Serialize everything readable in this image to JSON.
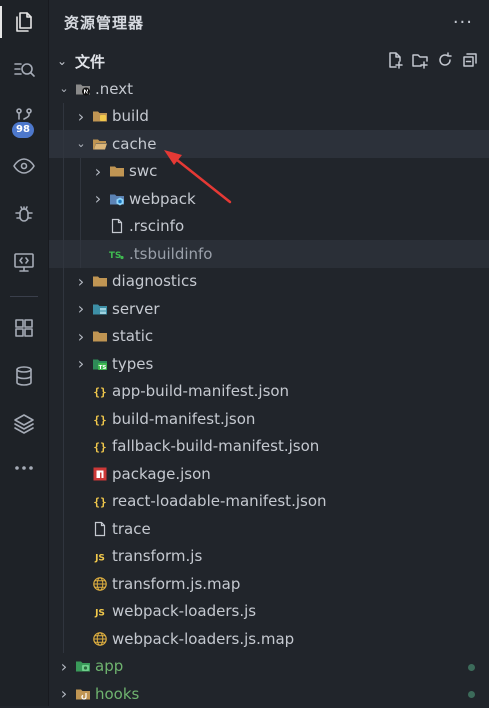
{
  "panel": {
    "title": "资源管理器",
    "more": "···"
  },
  "section": {
    "title": "文件"
  },
  "activity": {
    "badge": "98"
  },
  "tree": [
    {
      "label": ".next",
      "depth": 0,
      "chevron": "down",
      "icon": "next-folder-icon"
    },
    {
      "label": "build",
      "depth": 1,
      "chevron": "right",
      "icon": "folder-yellow-icon"
    },
    {
      "label": "cache",
      "depth": 1,
      "chevron": "down",
      "icon": "folder-open-icon"
    },
    {
      "label": "swc",
      "depth": 2,
      "chevron": "right",
      "icon": "folder-icon"
    },
    {
      "label": "webpack",
      "depth": 2,
      "chevron": "right",
      "icon": "webpack-folder-icon"
    },
    {
      "label": ".rscinfo",
      "depth": 2,
      "chevron": "none",
      "icon": "file-icon"
    },
    {
      "label": ".tsbuildinfo",
      "depth": 2,
      "chevron": "none",
      "icon": "ts-file-icon"
    },
    {
      "label": "diagnostics",
      "depth": 1,
      "chevron": "right",
      "icon": "folder-icon"
    },
    {
      "label": "server",
      "depth": 1,
      "chevron": "right",
      "icon": "server-folder-icon"
    },
    {
      "label": "static",
      "depth": 1,
      "chevron": "right",
      "icon": "folder-icon"
    },
    {
      "label": "types",
      "depth": 1,
      "chevron": "right",
      "icon": "ts-folder-icon"
    },
    {
      "label": "app-build-manifest.json",
      "depth": 1,
      "chevron": "none",
      "icon": "json-icon"
    },
    {
      "label": "build-manifest.json",
      "depth": 1,
      "chevron": "none",
      "icon": "json-icon"
    },
    {
      "label": "fallback-build-manifest.json",
      "depth": 1,
      "chevron": "none",
      "icon": "json-icon"
    },
    {
      "label": "package.json",
      "depth": 1,
      "chevron": "none",
      "icon": "npm-icon"
    },
    {
      "label": "react-loadable-manifest.json",
      "depth": 1,
      "chevron": "none",
      "icon": "json-icon"
    },
    {
      "label": "trace",
      "depth": 1,
      "chevron": "none",
      "icon": "file-icon"
    },
    {
      "label": "transform.js",
      "depth": 1,
      "chevron": "none",
      "icon": "js-icon"
    },
    {
      "label": "transform.js.map",
      "depth": 1,
      "chevron": "none",
      "icon": "map-icon"
    },
    {
      "label": "webpack-loaders.js",
      "depth": 1,
      "chevron": "none",
      "icon": "js-icon"
    },
    {
      "label": "webpack-loaders.js.map",
      "depth": 1,
      "chevron": "none",
      "icon": "map-icon"
    },
    {
      "label": "app",
      "depth": 0,
      "chevron": "right",
      "icon": "app-folder-icon"
    },
    {
      "label": "hooks",
      "depth": 0,
      "chevron": "right",
      "icon": "hooks-folder-icon"
    }
  ]
}
